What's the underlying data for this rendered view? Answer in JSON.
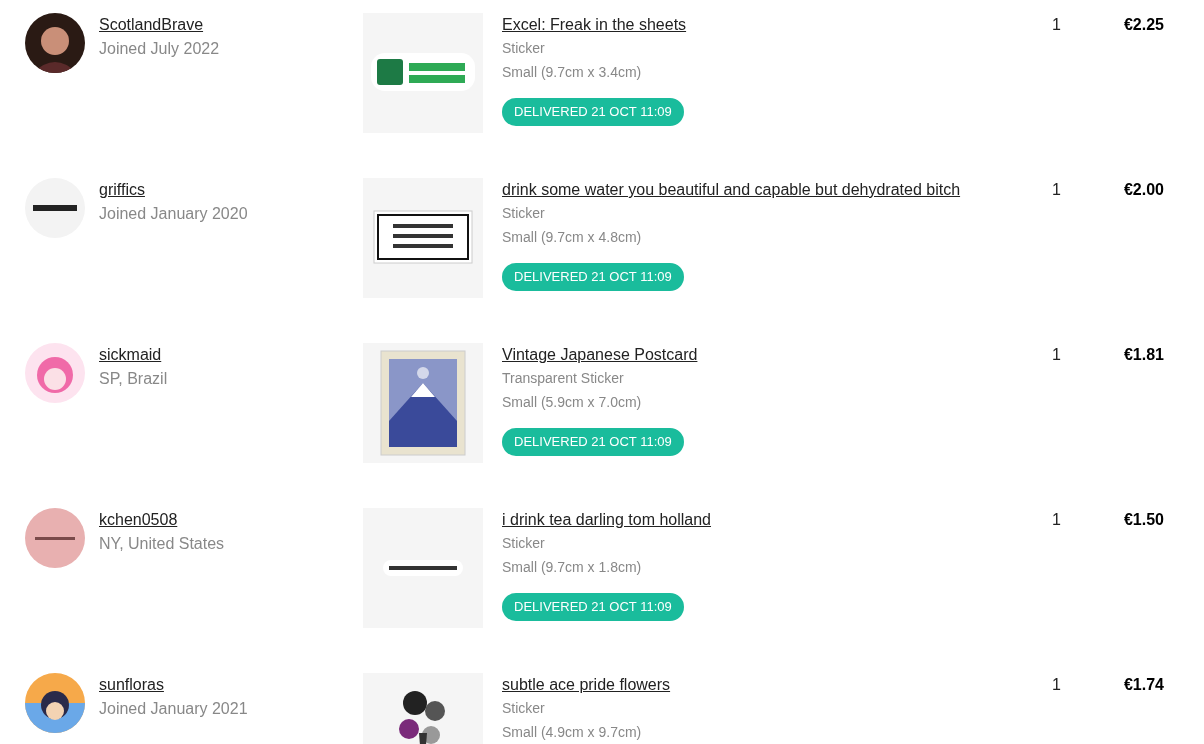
{
  "orders": [
    {
      "buyer": {
        "name": "ScotlandBrave",
        "subtitle": "Joined July 2022"
      },
      "product": {
        "title": "Excel: Freak in the sheets",
        "type": "Sticker",
        "size": "Small (9.7cm x 3.4cm)"
      },
      "status": "DELIVERED 21 OCT 11:09",
      "quantity": "1",
      "price": "€2.25"
    },
    {
      "buyer": {
        "name": "griffics",
        "subtitle": "Joined January 2020"
      },
      "product": {
        "title": "drink some water you beautiful and capable but dehydrated bitch",
        "type": "Sticker",
        "size": "Small (9.7cm x 4.8cm)"
      },
      "status": "DELIVERED 21 OCT 11:09",
      "quantity": "1",
      "price": "€2.00"
    },
    {
      "buyer": {
        "name": "sickmaid",
        "subtitle": "SP, Brazil"
      },
      "product": {
        "title": "Vintage Japanese Postcard",
        "type": "Transparent Sticker",
        "size": "Small (5.9cm x 7.0cm)"
      },
      "status": "DELIVERED 21 OCT 11:09",
      "quantity": "1",
      "price": "€1.81"
    },
    {
      "buyer": {
        "name": "kchen0508",
        "subtitle": "NY, United States"
      },
      "product": {
        "title": "i drink tea darling tom holland",
        "type": "Sticker",
        "size": "Small (9.7cm x 1.8cm)"
      },
      "status": "DELIVERED 21 OCT 11:09",
      "quantity": "1",
      "price": "€1.50"
    },
    {
      "buyer": {
        "name": "sunfloras",
        "subtitle": "Joined January 2021"
      },
      "product": {
        "title": "subtle ace pride flowers",
        "type": "Sticker",
        "size": "Small (4.9cm x 9.7cm)"
      },
      "quantity": "1",
      "price": "€1.74"
    }
  ]
}
